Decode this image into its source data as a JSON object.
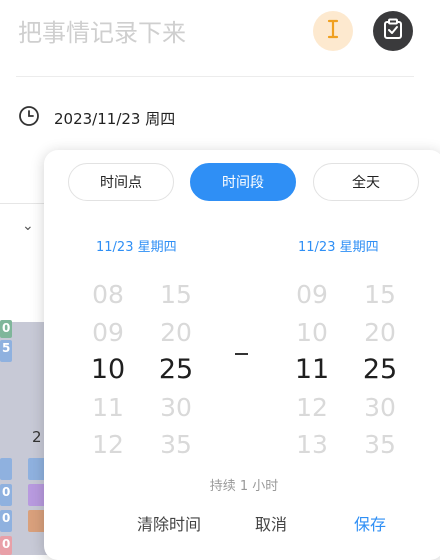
{
  "header": {
    "title_placeholder": "把事情记录下来",
    "date_text": "2023/11/23 周四"
  },
  "icons": {
    "cursor": "text-cursor-icon",
    "check": "clipboard-check-icon",
    "clock": "clock-icon"
  },
  "colors": {
    "accent": "#2f8ff5",
    "cursor_bg": "#fde9cf",
    "check_bg": "#3a3a3c"
  },
  "picker": {
    "tabs": [
      {
        "label": "时间点",
        "active": false
      },
      {
        "label": "时间段",
        "active": true
      },
      {
        "label": "全天",
        "active": false
      }
    ],
    "start": {
      "date_label": "11/23 星期四",
      "hours": [
        "08",
        "09",
        "10",
        "11",
        "12"
      ],
      "minutes": [
        "15",
        "20",
        "25",
        "30",
        "35"
      ]
    },
    "end": {
      "date_label": "11/23 星期四",
      "hours": [
        "09",
        "10",
        "11",
        "12",
        "13"
      ],
      "minutes": [
        "15",
        "20",
        "25",
        "30",
        "35"
      ]
    },
    "separator": "–",
    "duration": "持续 1 小时",
    "actions": {
      "clear": "清除时间",
      "cancel": "取消",
      "save": "保存"
    }
  },
  "background": {
    "day_number": "2",
    "strip_labels": [
      "0",
      "5",
      "0",
      "0",
      "0"
    ]
  }
}
